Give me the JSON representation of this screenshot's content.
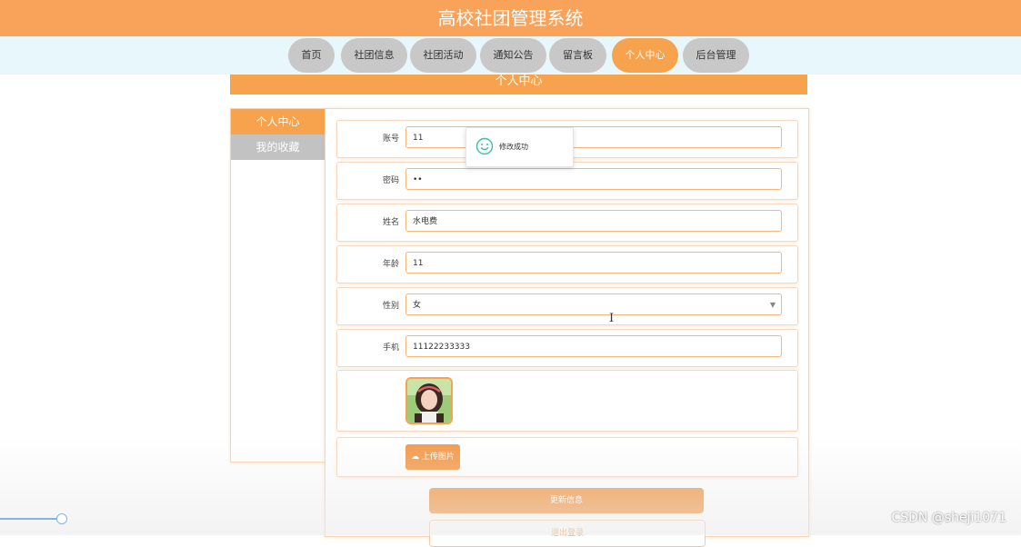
{
  "header": {
    "title": "高校社团管理系统"
  },
  "nav": {
    "items": [
      {
        "label": "首页"
      },
      {
        "label": "社团信息"
      },
      {
        "label": "社团活动"
      },
      {
        "label": "通知公告"
      },
      {
        "label": "留言板"
      },
      {
        "label": "个人中心"
      },
      {
        "label": "后台管理"
      }
    ],
    "active": "个人中心"
  },
  "page": {
    "section_title": "个人中心"
  },
  "sidebar": {
    "items": [
      {
        "label": "个人中心"
      },
      {
        "label": "我的收藏"
      }
    ]
  },
  "form": {
    "account_label": "账号",
    "account_value": "11",
    "password_label": "密码",
    "password_value": "••",
    "name_label": "姓名",
    "name_value": "水电费",
    "age_label": "年龄",
    "age_value": "11",
    "gender_label": "性别",
    "gender_value": "女",
    "phone_label": "手机",
    "phone_value": "11122233333"
  },
  "upload": {
    "label": "上传图片"
  },
  "buttons": {
    "update": "更新信息",
    "logout": "退出登录"
  },
  "toast": {
    "message": "修改成功"
  },
  "watermark": {
    "text": "CSDN @sheji1071"
  },
  "colors": {
    "accent": "#f7a24c",
    "nav_inactive": "#c8c8c8",
    "nav_bar_bg": "#e8f7fb",
    "toast_icon": "#3cc29a"
  },
  "icons": {
    "toast": "smile-icon",
    "upload": "cloud-upload-icon",
    "select": "chevron-down-icon"
  }
}
